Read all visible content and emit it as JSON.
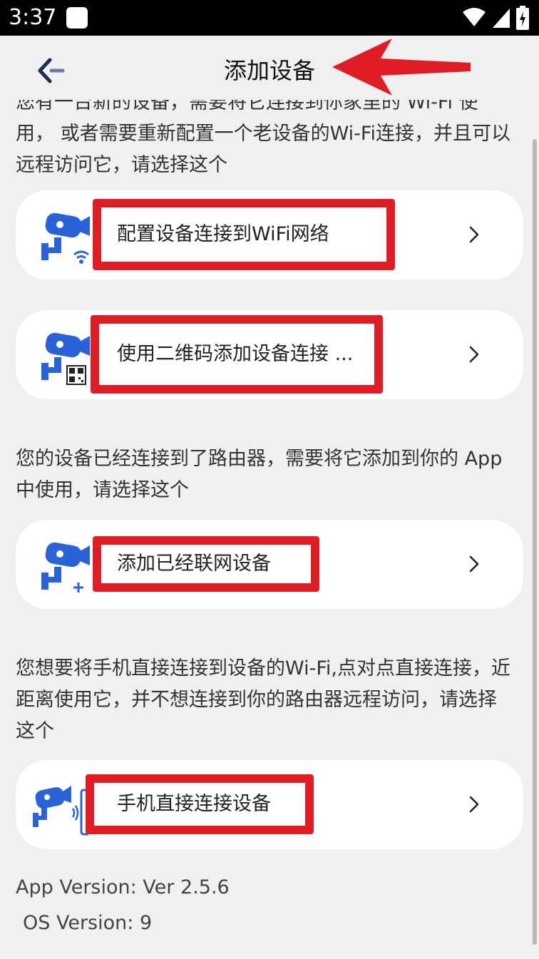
{
  "status_bar": {
    "time": "3:37"
  },
  "header": {
    "title": "添加设备"
  },
  "intro_cut": "您有一台新的设备，需要将它连接到你家里的 Wi-Fi 使",
  "sections": [
    {
      "description": "用， 或者需要重新配置一个老设备的Wi-Fi连接，并且可以远程访问它，请选择这个"
    },
    {
      "description": "您的设备已经连接到了路由器，需要将它添加到你的 App 中使用，请选择这个"
    },
    {
      "description": "您想要将手机直接连接到设备的Wi-Fi,点对点直接连接，近距离使用它，并不想连接到你的路由器远程访问，请选择这个"
    }
  ],
  "options": [
    {
      "label": "配置设备连接到WiFi网络",
      "icon": "camera-wifi-icon"
    },
    {
      "label": "使用二维码添加设备连接 ...",
      "icon": "camera-qr-icon"
    },
    {
      "label": "添加已经联网设备",
      "icon": "camera-add-icon"
    },
    {
      "label": "手机直接连接设备",
      "icon": "camera-phone-icon"
    }
  ],
  "footer": {
    "app_version": "App Version: Ver 2.5.6",
    "os_version": "OS Version: 9"
  },
  "colors": {
    "accent_blue": "#2a63d8",
    "annotation_red": "#e01c24",
    "background": "#f0f0f0"
  }
}
